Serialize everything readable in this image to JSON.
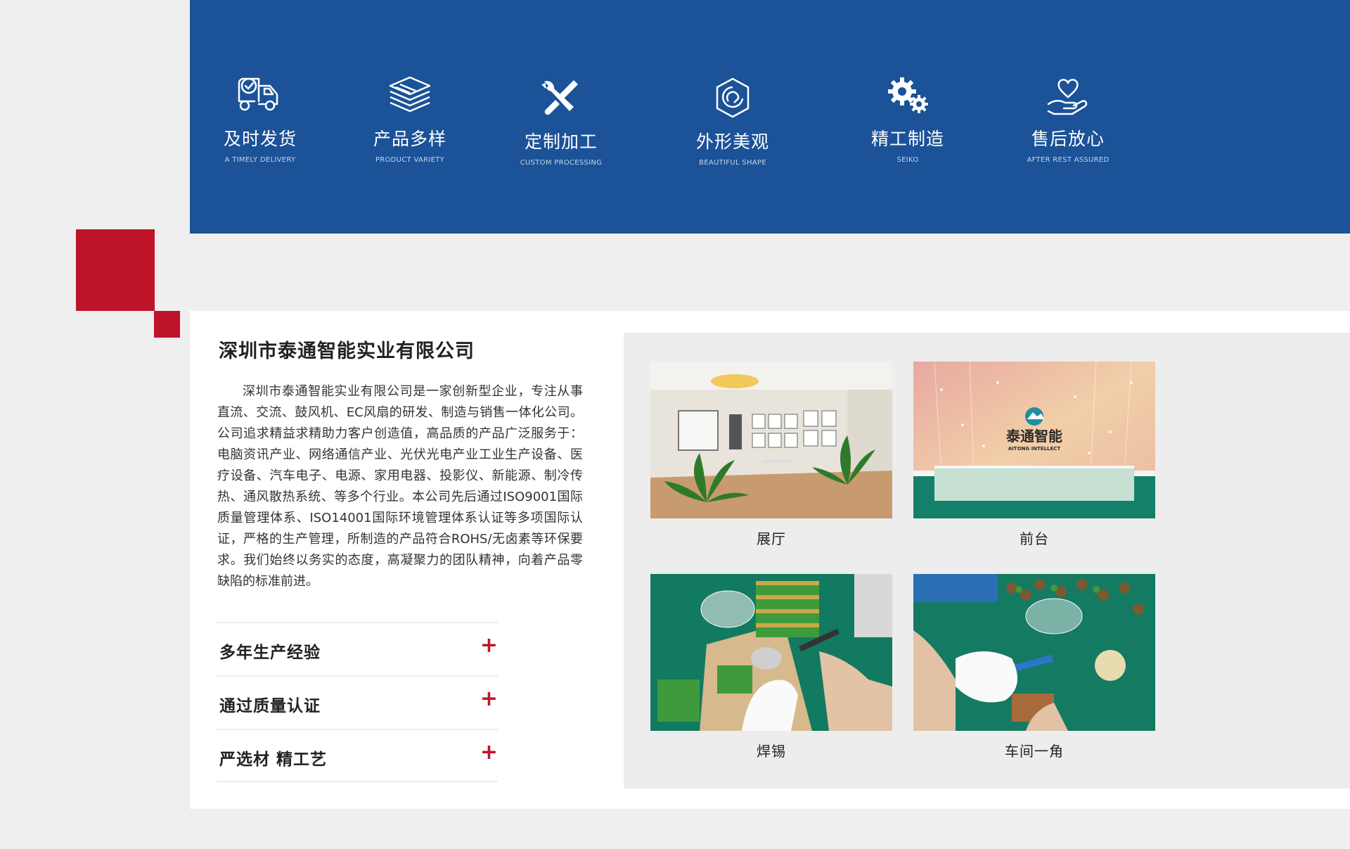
{
  "features": [
    {
      "icon": "delivery-truck-icon",
      "title": "及时发货",
      "subtitle": "A TIMELY DELIVERY"
    },
    {
      "icon": "layers-icon",
      "title": "产品多样",
      "subtitle": "PRODUCT VARIETY"
    },
    {
      "icon": "tools-icon",
      "title": "定制加工",
      "subtitle": "CUSTOM PROCESSING"
    },
    {
      "icon": "shape-hexagon-icon",
      "title": "外形美观",
      "subtitle": "BEAUTIFUL SHAPE"
    },
    {
      "icon": "gears-icon",
      "title": "精工制造",
      "subtitle": "SEIKO"
    },
    {
      "icon": "heart-hand-icon",
      "title": "售后放心",
      "subtitle": "AFTER REST ASSURED"
    }
  ],
  "company": {
    "name": "深圳市泰通智能实业有限公司",
    "description": "深圳市泰通智能实业有限公司是一家创新型企业，专注从事直流、交流、鼓风机、EC风扇的研发、制造与销售一体化公司。公司追求精益求精助力客户创造值，高品质的产品广泛服务于：电脑资讯产业、网络通信产业、光伏光电产业工业生产设备、医疗设备、汽车电子、电源、家用电器、投影仪、新能源、制冷传热、通风散热系统、等多个行业。本公司先后通过ISO9001国际质量管理体系、ISO14001国际环境管理体系认证等多项国际认证，严格的生产管理，所制造的产品符合ROHS/无卤素等环保要求。我们始终以务实的态度，高凝聚力的团队精神，向着产品零缺陷的标准前进。"
  },
  "advantages": [
    {
      "label": "多年生产经验",
      "icon": "plus-icon"
    },
    {
      "label": "通过质量认证",
      "icon": "plus-icon"
    },
    {
      "label": "严选材 精工艺",
      "icon": "plus-icon"
    }
  ],
  "gallery": [
    {
      "caption": "展厅"
    },
    {
      "caption": "前台",
      "logo_text": "泰通智能",
      "logo_sub": "AITONG INTELLECT"
    },
    {
      "caption": "焊锡"
    },
    {
      "caption": "车间一角"
    }
  ],
  "colors": {
    "banner": "#1b5298",
    "accent": "#bf1329"
  }
}
